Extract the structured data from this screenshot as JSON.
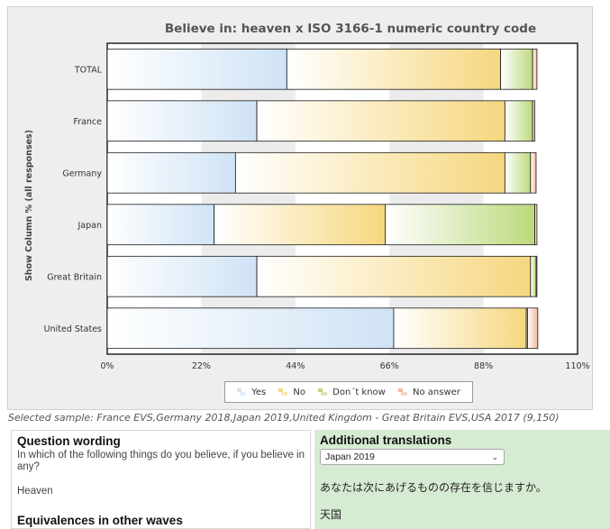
{
  "chart_data": {
    "type": "bar",
    "orientation": "horizontal",
    "stacked": true,
    "title": "Believe in: heaven x ISO 3166-1 numeric country code",
    "ylabel": "Show Column % (all responses)",
    "categories": [
      "TOTAL",
      "France",
      "Germany",
      "Japan",
      "Great Britain",
      "United States"
    ],
    "xlim": [
      0,
      110
    ],
    "xticks": [
      "0%",
      "22%",
      "44%",
      "66%",
      "88%",
      "110%"
    ],
    "series": [
      {
        "name": "Yes",
        "values": [
          42,
          35,
          30,
          25,
          35,
          67
        ],
        "color": "#cfe3f5"
      },
      {
        "name": "No",
        "values": [
          50,
          58,
          63,
          40,
          64,
          31
        ],
        "color": "#f6d77f"
      },
      {
        "name": "Don´t know",
        "values": [
          7.5,
          6.5,
          6,
          35,
          1.3,
          0.3
        ],
        "color": "#bcd97c"
      },
      {
        "name": "No answer",
        "values": [
          1,
          0.5,
          1.3,
          0.5,
          0.2,
          2.4
        ],
        "color": "#f6b89a"
      }
    ],
    "grid": true,
    "legend_position": "bottom"
  },
  "sample_text": "Selected sample: France EVS,Germany 2018,Japan 2019,United Kingdom - Great Britain EVS,USA 2017 (9,150)",
  "question": {
    "title": "Question wording",
    "text": "In which of the following things do you believe, if you believe in any?",
    "answer": "Heaven",
    "equivalences_title": "Equivalences in other waves"
  },
  "translations": {
    "title": "Additional translations",
    "selected": "Japan 2019",
    "question_jp": "あなたは次にあげるものの存在を信じますか。",
    "answer_jp": "天国"
  }
}
